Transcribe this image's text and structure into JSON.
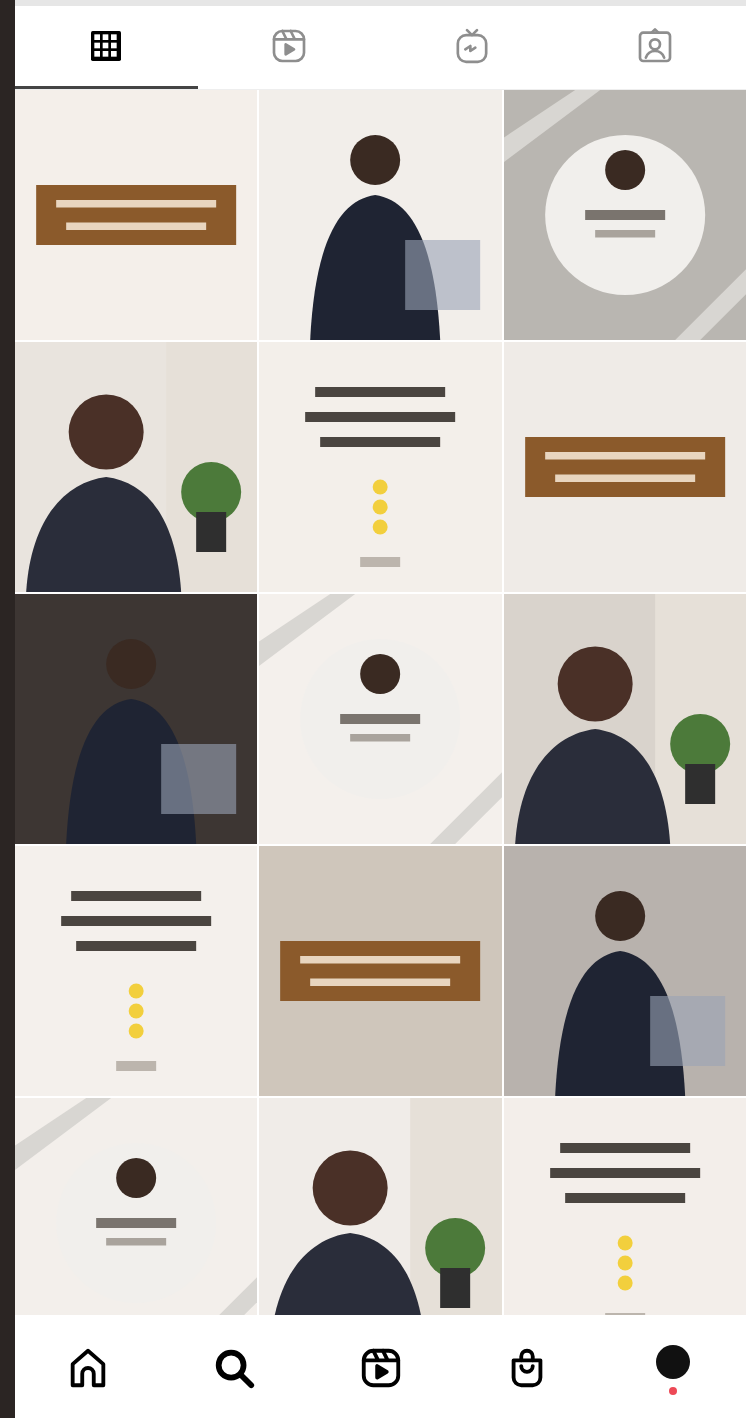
{
  "profile_tabs": [
    {
      "kind": "grid",
      "selected": true
    },
    {
      "kind": "reels",
      "selected": false
    },
    {
      "kind": "tv",
      "selected": false
    },
    {
      "kind": "tagged",
      "selected": false
    }
  ],
  "bottom_nav": [
    {
      "kind": "home"
    },
    {
      "kind": "search"
    },
    {
      "kind": "reels"
    },
    {
      "kind": "shop"
    },
    {
      "kind": "profile",
      "badge": true
    }
  ]
}
